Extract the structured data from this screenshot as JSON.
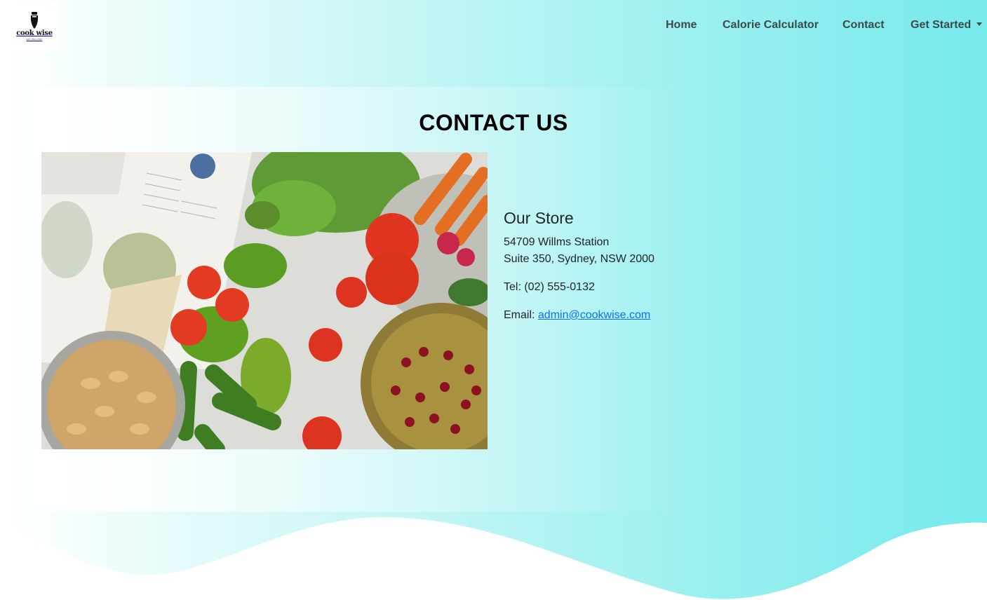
{
  "brand": {
    "logo_text": "cook wise",
    "logo_tagline": "EAT LIKE A PRO"
  },
  "nav": {
    "items": [
      {
        "label": "Home"
      },
      {
        "label": "Calorie Calculator"
      },
      {
        "label": "Contact"
      },
      {
        "label": "Get Started"
      }
    ]
  },
  "main": {
    "title": "CONTACT US",
    "image_icon": "vegetables-photo",
    "store": {
      "heading": "Our Store",
      "address_line1": "54709 Willms Station",
      "address_line2": "Suite 350, Sydney, NSW 2000",
      "tel": "Tel: (02) 555-0132",
      "email_label": "Email: ",
      "email": "admin@cookwise.com"
    }
  },
  "colors": {
    "gradient_start": "#ffffff",
    "gradient_end": "#76e9eb",
    "link": "#0d6efd",
    "nav_text": "#3c4a4a"
  }
}
